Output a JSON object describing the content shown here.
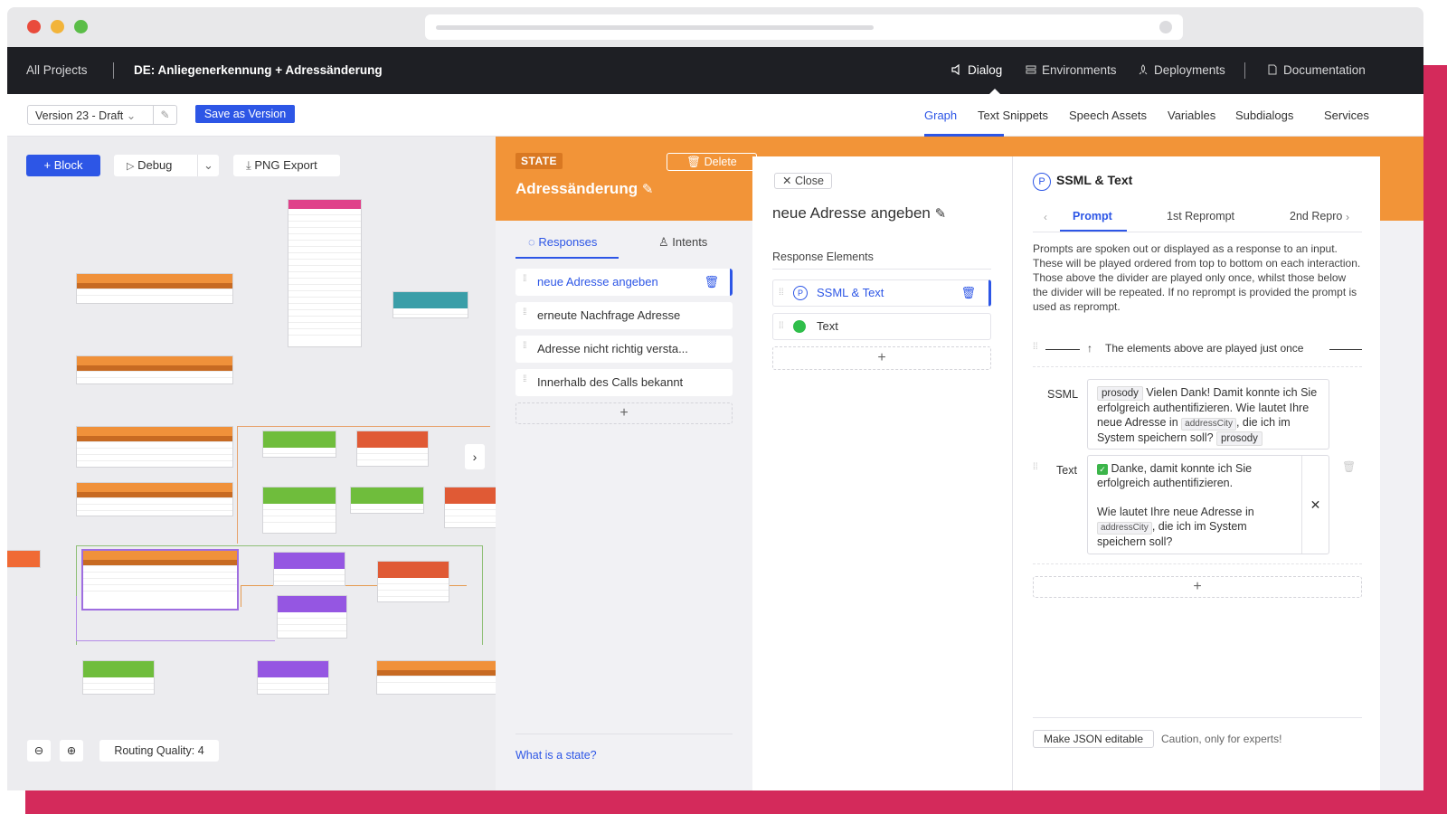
{
  "colors": {
    "accent": "#2d56e6",
    "brand_orange": "#f29438",
    "frame_magenta": "#d42a5b",
    "nav_bg": "#1e1f24"
  },
  "nav": {
    "all_projects": "All Projects",
    "project_title": "DE: Anliegenerkennung + Adressänderung",
    "dialog": "Dialog",
    "environments": "Environments",
    "deployments": "Deployments",
    "documentation": "Documentation"
  },
  "subbar": {
    "version": "Version 23 - Draft",
    "save_as_version": "Save as Version",
    "tabs": [
      "Graph",
      "Text Snippets",
      "Speech Assets",
      "Variables",
      "Subdialogs",
      "Services"
    ],
    "active_tab": "Graph"
  },
  "graph": {
    "block_button": "Block",
    "debug_button": "Debug",
    "png_export_button": "PNG Export",
    "routing_quality": "Routing Quality: 4"
  },
  "state": {
    "badge": "STATE",
    "delete": "Delete",
    "title": "Adressänderung",
    "tabs": {
      "responses": "Responses",
      "intents": "Intents"
    },
    "responses": [
      "neue Adresse angeben",
      "erneute Nachfrage Adresse",
      "Adresse nicht richtig versta...",
      "Innerhalb des Calls bekannt"
    ],
    "help_link": "What is a state?"
  },
  "response": {
    "close": "Close",
    "title": "neue Adresse angeben",
    "elements_label": "Response Elements",
    "elements": [
      "SSML & Text",
      "Text"
    ]
  },
  "detail": {
    "title": "SSML & Text",
    "tabs": [
      "Prompt",
      "1st Reprompt",
      "2nd Repro"
    ],
    "description": "Prompts are spoken out or displayed as a response to an input. These will be played ordered from top to bottom on each interaction. Those above the divider are played only once, whilst those below the divider will be repeated. If no reprompt is provided the prompt is used as reprompt.",
    "divider_text": "The elements above are played just once",
    "ssml_label": "SSML",
    "ssml_tag": "prosody",
    "ssml_text_1": "Vielen Dank! Damit konnte ich Sie erfolgreich authentifizieren. Wie lautet Ihre neue Adresse in",
    "ssml_var": "addressCity",
    "ssml_text_2": ", die ich im System speichern soll?",
    "text_label": "Text",
    "text_line_1": "Danke, damit konnte ich Sie erfolgreich authentifizieren.",
    "text_line_2": "Wie lautet Ihre neue Adresse in",
    "text_var": "addressCity",
    "text_line_3": ", die ich im System speichern soll?",
    "json_button": "Make JSON editable",
    "json_caution": "Caution, only for experts!"
  }
}
